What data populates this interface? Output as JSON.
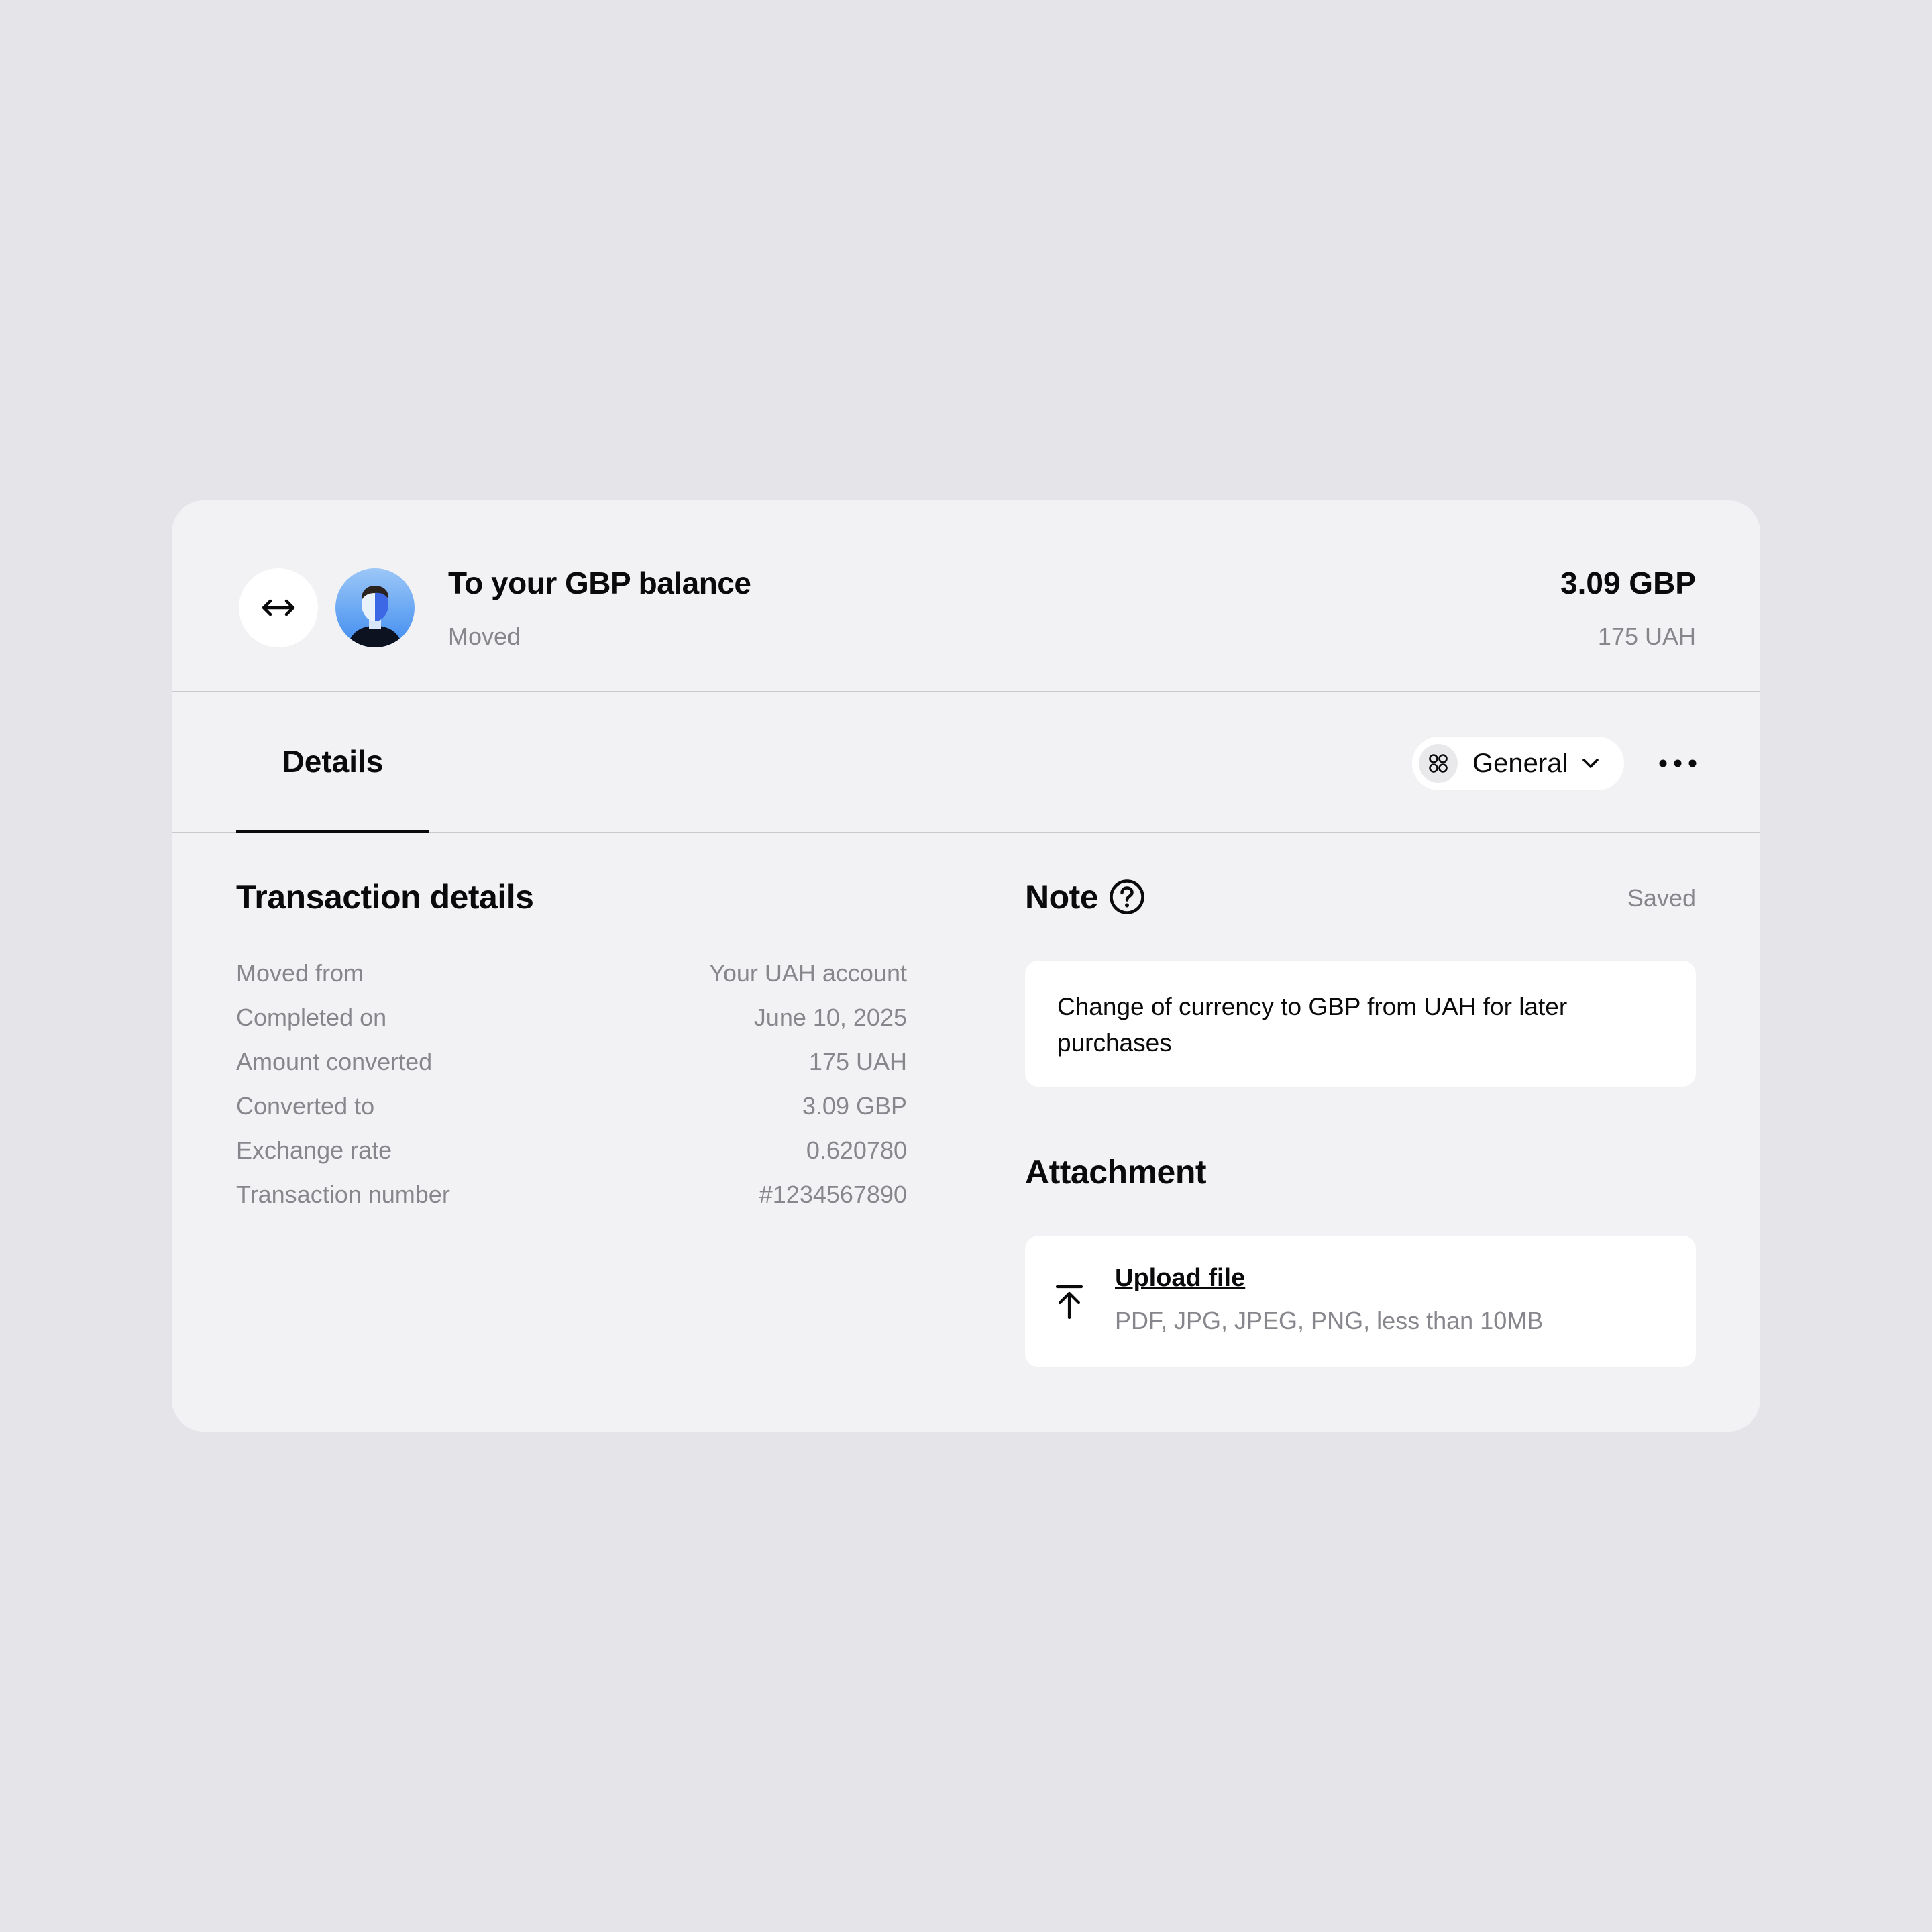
{
  "header": {
    "title": "To your GBP balance",
    "status": "Moved",
    "amount_primary": "3.09 GBP",
    "amount_secondary": "175 UAH",
    "swap_icon": "swap-arrows-icon",
    "avatar_icon": "user-avatar"
  },
  "tabs": {
    "active_label": "Details"
  },
  "category": {
    "label": "General",
    "icon": "category-grid-icon"
  },
  "transaction": {
    "title": "Transaction details",
    "rows": [
      {
        "label": "Moved from",
        "value": "Your UAH account"
      },
      {
        "label": "Completed on",
        "value": "June 10, 2025"
      },
      {
        "label": "Amount converted",
        "value": "175 UAH"
      },
      {
        "label": "Converted to",
        "value": "3.09 GBP"
      },
      {
        "label": "Exchange rate",
        "value": "0.620780"
      },
      {
        "label": "Transaction number",
        "value": "#1234567890"
      }
    ]
  },
  "note": {
    "title": "Note",
    "status": "Saved",
    "text": "Change of currency to GBP from UAH for later purchases"
  },
  "attachment": {
    "title": "Attachment",
    "upload_label": "Upload file",
    "upload_hint": "PDF, JPG, JPEG, PNG, less than 10MB"
  },
  "colors": {
    "page_bg": "#e5e4e9",
    "card_bg": "#f2f2f4",
    "muted_text": "#86868c",
    "avatar_blue": "#3b82f6"
  }
}
